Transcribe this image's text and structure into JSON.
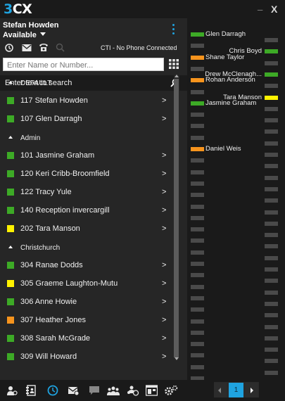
{
  "app": {
    "logo_num": "3",
    "logo_cx": "CX",
    "minimize_label": "_",
    "close_label": "X"
  },
  "user": {
    "name": "Stefan Howden",
    "status": "Available"
  },
  "toolbar": {
    "icons": [
      "refresh-icon",
      "voicemail-icon",
      "phone-icon",
      "search-icon"
    ],
    "cti_status": "CTI - No Phone Connected"
  },
  "search": {
    "placeholder": "Enter Name or Number...",
    "value": ""
  },
  "filter": {
    "placeholder": "Enter text to search"
  },
  "colors": {
    "accent": "#1fa3e0",
    "available": "#3daa26",
    "away": "#f7941d",
    "busy": "#fff200",
    "offline": "#4a4a4a"
  },
  "contacts": [
    {
      "type": "group",
      "label": "DEFAULT"
    },
    {
      "type": "contact",
      "label": "117 Stefan Howden",
      "status": "available"
    },
    {
      "type": "contact",
      "label": "107 Glen Darragh",
      "status": "available"
    },
    {
      "type": "group",
      "label": "Admin"
    },
    {
      "type": "contact",
      "label": "101 Jasmine Graham",
      "status": "available"
    },
    {
      "type": "contact",
      "label": "120 Keri Cribb-Broomfield",
      "status": "available"
    },
    {
      "type": "contact",
      "label": "122 Tracy Yule",
      "status": "available"
    },
    {
      "type": "contact",
      "label": "140 Reception invercargill",
      "status": "available"
    },
    {
      "type": "contact",
      "label": "202 Tara Manson",
      "status": "busy"
    },
    {
      "type": "group",
      "label": "Christchurch"
    },
    {
      "type": "contact",
      "label": "304 Ranae Dodds",
      "status": "available"
    },
    {
      "type": "contact",
      "label": "305 Graeme Laughton-Mutu",
      "status": "busy"
    },
    {
      "type": "contact",
      "label": "306 Anne Howie",
      "status": "available"
    },
    {
      "type": "contact",
      "label": "307 Heather Jones",
      "status": "away"
    },
    {
      "type": "contact",
      "label": "308 Sarah McGrade",
      "status": "available"
    },
    {
      "type": "contact",
      "label": "309 Will Howard",
      "status": "available"
    }
  ],
  "contact_arrow": ">",
  "presence_panel": {
    "left_column": [
      {
        "label": "Glen Darragh",
        "status": "available"
      },
      {
        "label": "",
        "status": "offline"
      },
      {
        "label": "Shane Taylor",
        "status": "away"
      },
      {
        "label": "",
        "status": "offline"
      },
      {
        "label": "Rohan Anderson",
        "status": "away"
      },
      {
        "label": "",
        "status": "offline"
      },
      {
        "label": "Jasmine Graham",
        "status": "available"
      },
      {
        "label": "",
        "status": "offline"
      },
      {
        "label": "",
        "status": "offline"
      },
      {
        "label": "",
        "status": "offline"
      },
      {
        "label": "Daniel Weis",
        "status": "away"
      },
      {
        "label": "",
        "status": "offline"
      },
      {
        "label": "",
        "status": "offline"
      },
      {
        "label": "",
        "status": "offline"
      },
      {
        "label": "",
        "status": "offline"
      },
      {
        "label": "",
        "status": "offline"
      },
      {
        "label": "",
        "status": "offline"
      },
      {
        "label": "",
        "status": "offline"
      },
      {
        "label": "",
        "status": "offline"
      },
      {
        "label": "",
        "status": "offline"
      },
      {
        "label": "",
        "status": "offline"
      },
      {
        "label": "",
        "status": "offline"
      },
      {
        "label": "",
        "status": "offline"
      },
      {
        "label": "",
        "status": "offline"
      },
      {
        "label": "",
        "status": "offline"
      },
      {
        "label": "",
        "status": "offline"
      },
      {
        "label": "",
        "status": "offline"
      },
      {
        "label": "",
        "status": "offline"
      },
      {
        "label": "",
        "status": "offline"
      },
      {
        "label": "",
        "status": "offline"
      },
      {
        "label": "",
        "status": "offline"
      },
      {
        "label": "",
        "status": "offline"
      }
    ],
    "right_column": [
      {
        "label": "",
        "status": "offline"
      },
      {
        "label": "Chris Boyd",
        "status": "available"
      },
      {
        "label": "",
        "status": "offline"
      },
      {
        "label": "Drew McClenagh...",
        "status": "available"
      },
      {
        "label": "",
        "status": "offline"
      },
      {
        "label": "Tara Manson",
        "status": "busy"
      },
      {
        "label": "",
        "status": "offline"
      },
      {
        "label": "",
        "status": "offline"
      },
      {
        "label": "",
        "status": "offline"
      },
      {
        "label": "",
        "status": "offline"
      },
      {
        "label": "",
        "status": "offline"
      },
      {
        "label": "",
        "status": "offline"
      },
      {
        "label": "",
        "status": "offline"
      },
      {
        "label": "",
        "status": "offline"
      },
      {
        "label": "",
        "status": "offline"
      },
      {
        "label": "",
        "status": "offline"
      },
      {
        "label": "",
        "status": "offline"
      },
      {
        "label": "",
        "status": "offline"
      },
      {
        "label": "",
        "status": "offline"
      },
      {
        "label": "",
        "status": "offline"
      },
      {
        "label": "",
        "status": "offline"
      },
      {
        "label": "",
        "status": "offline"
      },
      {
        "label": "",
        "status": "offline"
      },
      {
        "label": "",
        "status": "offline"
      },
      {
        "label": "",
        "status": "offline"
      },
      {
        "label": "",
        "status": "offline"
      },
      {
        "label": "",
        "status": "offline"
      },
      {
        "label": "",
        "status": "offline"
      },
      {
        "label": "",
        "status": "offline"
      },
      {
        "label": "",
        "status": "offline"
      },
      {
        "label": "",
        "status": "offline"
      },
      {
        "label": "",
        "status": "offline"
      }
    ]
  },
  "bottom_bar": {
    "icons": [
      "user-settings-icon",
      "contacts-book-icon",
      "history-icon",
      "voicemail-inbox-icon",
      "chat-icon",
      "group-icon",
      "conference-icon",
      "switchboard-icon",
      "settings-icon"
    ]
  },
  "pager": {
    "current_page": "1"
  }
}
